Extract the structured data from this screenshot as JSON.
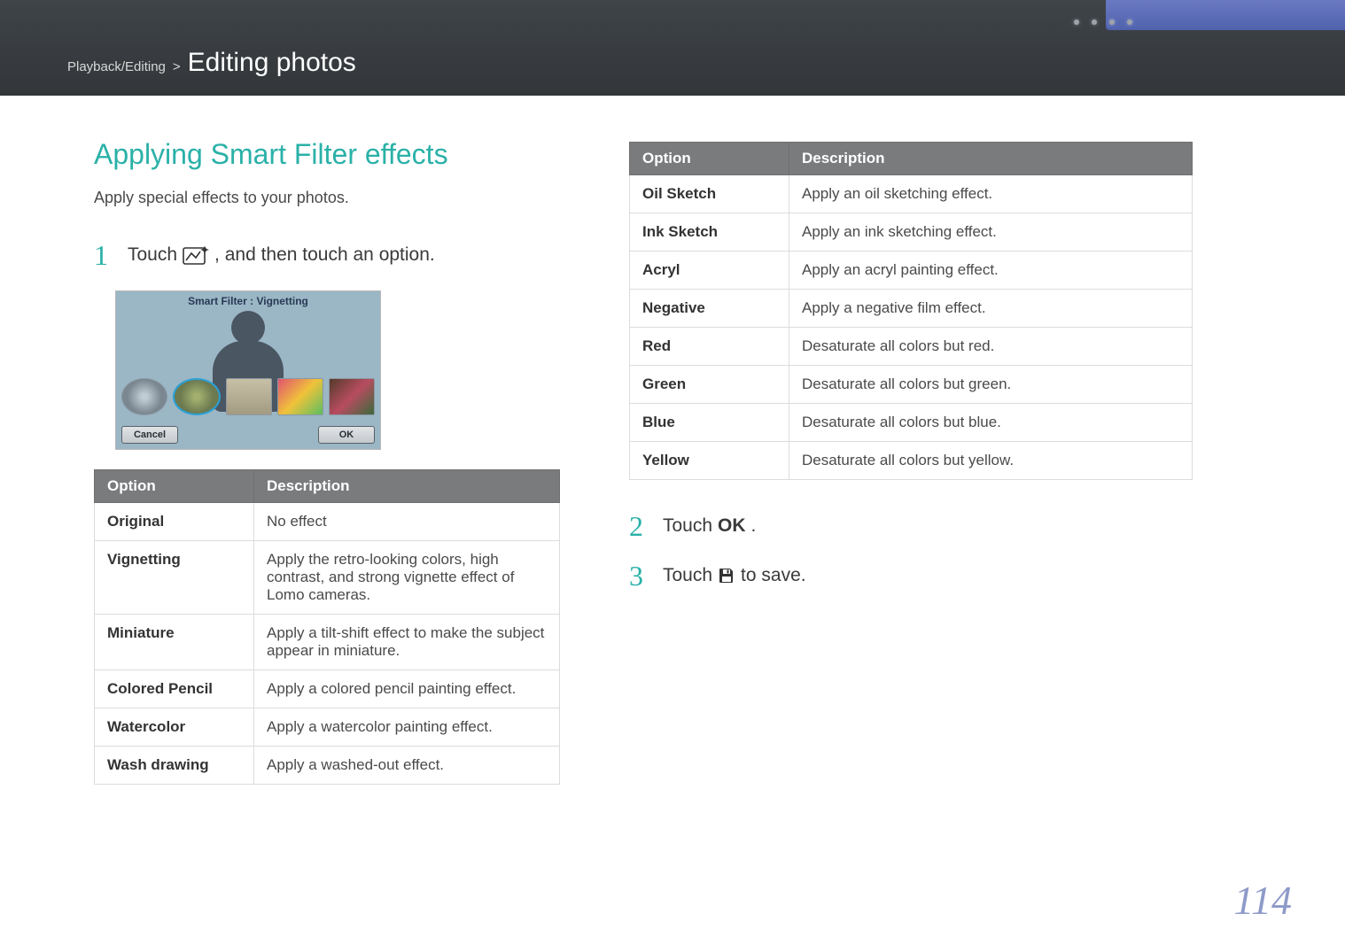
{
  "header": {
    "breadcrumb_category": "Playback/Editing",
    "breadcrumb_sep": ">",
    "section_title": "Editing photos"
  },
  "left": {
    "heading": "Applying Smart Filter effects",
    "lead": "Apply special effects to your photos.",
    "step1_a": "Touch",
    "step1_b": ", and then touch an option.",
    "camshot": {
      "title": "Smart Filter : Vignetting",
      "cancel": "Cancel",
      "ok": "OK"
    },
    "table": {
      "head_option": "Option",
      "head_desc": "Description",
      "rows": [
        {
          "name": "Original",
          "desc": "No effect"
        },
        {
          "name": "Vignetting",
          "desc": "Apply the retro-looking colors, high contrast, and strong vignette effect of Lomo cameras."
        },
        {
          "name": "Miniature",
          "desc": "Apply a tilt-shift effect to make the subject appear in miniature."
        },
        {
          "name": "Colored Pencil",
          "desc": "Apply a colored pencil painting effect."
        },
        {
          "name": "Watercolor",
          "desc": "Apply a watercolor painting effect."
        },
        {
          "name": "Wash drawing",
          "desc": "Apply a washed-out effect."
        }
      ]
    }
  },
  "right": {
    "table": {
      "head_option": "Option",
      "head_desc": "Description",
      "rows": [
        {
          "name": "Oil Sketch",
          "desc": "Apply an oil sketching effect."
        },
        {
          "name": "Ink Sketch",
          "desc": "Apply an ink sketching effect."
        },
        {
          "name": "Acryl",
          "desc": "Apply an acryl painting effect."
        },
        {
          "name": "Negative",
          "desc": "Apply a negative film effect."
        },
        {
          "name": "Red",
          "desc": "Desaturate all colors but red."
        },
        {
          "name": "Green",
          "desc": "Desaturate all colors but green."
        },
        {
          "name": "Blue",
          "desc": "Desaturate all colors but blue."
        },
        {
          "name": "Yellow",
          "desc": "Desaturate all colors but yellow."
        }
      ]
    },
    "step2_a": "Touch ",
    "step2_b": "OK",
    "step2_c": ".",
    "step3_a": "Touch",
    "step3_b": "to save."
  },
  "page_number": "114"
}
